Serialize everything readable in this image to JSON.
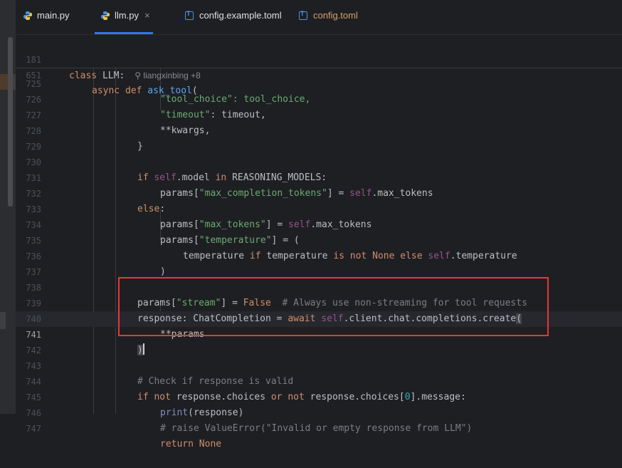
{
  "tabs": [
    {
      "label": "main.py",
      "icon": "python-icon",
      "color": "#dfe1e5",
      "active": false
    },
    {
      "label": "llm.py",
      "icon": "python-icon",
      "color": "#dfe1e5",
      "active": true,
      "close": "×"
    },
    {
      "label": "config.example.toml",
      "icon": "toml-icon",
      "color": "#dfe1e5",
      "active": false
    },
    {
      "label": "config.toml",
      "icon": "toml-icon",
      "color": "#d5a06a",
      "active": false
    }
  ],
  "sticky": {
    "line1": {
      "number": "181",
      "keyword": "class",
      "name": "LLM:",
      "author": "liangxinbing +8"
    },
    "line2": {
      "number": "651",
      "keyword": "async def",
      "name": "ask_tool",
      "punct": "("
    }
  },
  "lines": {
    "l725": {
      "n": "725",
      "a": "\"tool_choice\": tool_choice,"
    },
    "l726": {
      "n": "726",
      "s": "\"timeout\"",
      "a": ": timeout,"
    },
    "l727": {
      "n": "727",
      "a": "**kwargs,"
    },
    "l728": {
      "n": "728",
      "a": "}"
    },
    "l729": {
      "n": "729"
    },
    "l730": {
      "n": "730",
      "k1": "if",
      "s1": "self",
      "a": ".model ",
      "k2": "in",
      "b": " REASONING_MODELS:"
    },
    "l731": {
      "n": "731",
      "a": "params[",
      "s": "\"max_completion_tokens\"",
      "b": "] = ",
      "s1": "self",
      "c": ".max_tokens"
    },
    "l732": {
      "n": "732",
      "k": "else",
      "a": ":"
    },
    "l733": {
      "n": "733",
      "a": "params[",
      "s": "\"max_tokens\"",
      "b": "] = ",
      "s1": "self",
      "c": ".max_tokens"
    },
    "l734": {
      "n": "734",
      "a": "params[",
      "s": "\"temperature\"",
      "b": "] = ("
    },
    "l735": {
      "n": "735",
      "a": "temperature ",
      "k1": "if",
      "b": " temperature ",
      "k2": "is not None else",
      "s1": " self",
      "c": ".temperature"
    },
    "l736": {
      "n": "736",
      "a": ")"
    },
    "l737": {
      "n": "737"
    },
    "l738": {
      "n": "738",
      "a": "params[",
      "s": "\"stream\"",
      "b": "] = ",
      "k": "False",
      "cm": "  # Always use non-streaming for tool requests"
    },
    "l739": {
      "n": "739",
      "a": "response: ChatCompletion = ",
      "k": "await",
      "s1": " self",
      "b": ".client.chat.completions.create",
      "c": "("
    },
    "l740": {
      "n": "740",
      "a": "**params"
    },
    "l741": {
      "n": "741",
      "a": ")"
    },
    "l742": {
      "n": "742"
    },
    "l743": {
      "n": "743",
      "cm": "# Check if response is valid"
    },
    "l744": {
      "n": "744",
      "k1": "if not",
      "a": " response.choices ",
      "k2": "or not",
      "b": " response.choices[",
      "num": "0",
      "c": "].message:"
    },
    "l745": {
      "n": "745",
      "bi": "print",
      "a": "(response)"
    },
    "l746": {
      "n": "746",
      "cm": "# raise ValueError(\"Invalid or empty response from LLM\")"
    },
    "l747": {
      "n": "747",
      "k": "return None"
    }
  },
  "colors": {
    "accent": "#3574f0",
    "highlight_box": "#e53935",
    "background": "#1e1f22"
  }
}
